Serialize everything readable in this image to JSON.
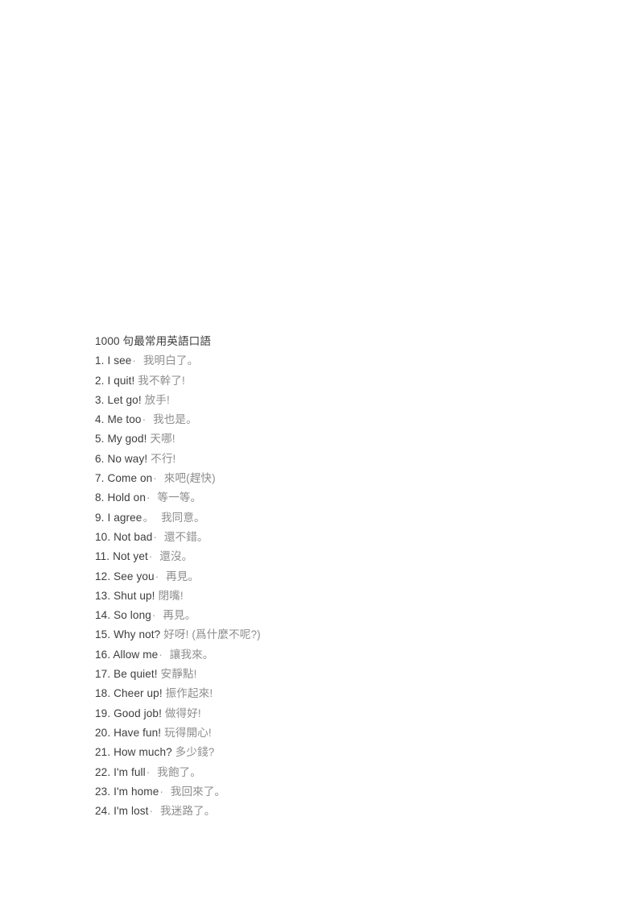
{
  "document": {
    "title": "1000 句最常用英語口語",
    "page_background": "#ffffff",
    "english_text_color": "#3d3d3d",
    "chinese_text_color": "#8e8e8e",
    "separator_color": "#9a9a9a",
    "items": [
      {
        "number": "1.",
        "english": "I see",
        "separator": "·",
        "chinese": "我明白了。"
      },
      {
        "number": "2.",
        "english": "I quit!",
        "separator": "",
        "chinese": "我不幹了!"
      },
      {
        "number": "3.",
        "english": "Let go!",
        "separator": "",
        "chinese": "放手!"
      },
      {
        "number": "4.",
        "english": "Me too",
        "separator": "·",
        "chinese": "我也是。"
      },
      {
        "number": "5.",
        "english": "My god!",
        "separator": "",
        "chinese": "天哪!"
      },
      {
        "number": "6.",
        "english": "No way!",
        "separator": "",
        "chinese": "不行!"
      },
      {
        "number": "7.",
        "english": "Come on",
        "separator": "·",
        "chinese": "來吧(趕快)"
      },
      {
        "number": "8.",
        "english": "Hold on",
        "separator": "·",
        "chinese": "等一等。"
      },
      {
        "number": "9.",
        "english": "I agree",
        "separator": "。",
        "chinese": "我同意。"
      },
      {
        "number": "10.",
        "english": "Not bad",
        "separator": "·",
        "chinese": "還不錯。"
      },
      {
        "number": "11.",
        "english": "Not yet",
        "separator": "·",
        "chinese": "還沒。"
      },
      {
        "number": "12.",
        "english": "See you",
        "separator": "·",
        "chinese": "再見。"
      },
      {
        "number": "13.",
        "english": "Shut up!",
        "separator": "",
        "chinese": "閉嘴!"
      },
      {
        "number": "14.",
        "english": "So long",
        "separator": "·",
        "chinese": "再見。"
      },
      {
        "number": "15.",
        "english": "Why not?",
        "separator": "",
        "chinese": "好呀! (爲什麼不呢?)"
      },
      {
        "number": "16.",
        "english": "Allow me",
        "separator": "·",
        "chinese": "讓我來。"
      },
      {
        "number": "17.",
        "english": "Be quiet!",
        "separator": "",
        "chinese": "安靜點!"
      },
      {
        "number": "18.",
        "english": "Cheer up!",
        "separator": "",
        "chinese": "振作起來!"
      },
      {
        "number": "19.",
        "english": "Good job!",
        "separator": "",
        "chinese": "做得好!"
      },
      {
        "number": "20.",
        "english": "Have fun!",
        "separator": "",
        "chinese": "玩得開心!"
      },
      {
        "number": "21.",
        "english": "How much?",
        "separator": "",
        "chinese": "多少錢?"
      },
      {
        "number": "22.",
        "english": "I'm full",
        "separator": "·",
        "chinese": "我飽了。"
      },
      {
        "number": "23.",
        "english": "I'm home",
        "separator": "·",
        "chinese": "我回來了。"
      },
      {
        "number": "24.",
        "english": "I'm lost",
        "separator": "·",
        "chinese": "我迷路了。"
      }
    ]
  }
}
